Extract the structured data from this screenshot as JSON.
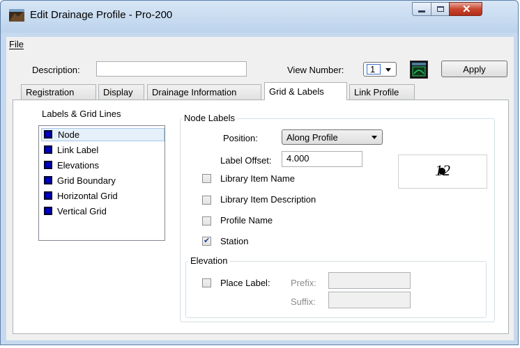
{
  "window": {
    "title": "Edit Drainage Profile - Pro-200",
    "icon": "drainage-profile-icon",
    "titlebar_buttons": [
      "minimize-icon",
      "maximize-icon",
      "close-icon"
    ]
  },
  "menu": {
    "file": "File"
  },
  "toolbar": {
    "description_label": "Description:",
    "description_value": "",
    "view_number_label": "View Number:",
    "view_number_value": "1",
    "view_icon": "view-window-icon",
    "apply_label": "Apply"
  },
  "tabs": [
    {
      "label": "Registration"
    },
    {
      "label": "Display"
    },
    {
      "label": "Drainage Information"
    },
    {
      "label": "Grid & Labels",
      "active": true
    },
    {
      "label": "Link Profile"
    }
  ],
  "labels_grid": {
    "title": "Labels & Grid Lines",
    "items": [
      "Node",
      "Link Label",
      "Elevations",
      "Grid Boundary",
      "Horizontal Grid",
      "Vertical Grid"
    ],
    "selected": "Node",
    "swatch_color": "#000080"
  },
  "node_labels": {
    "title": "Node Labels",
    "position_label": "Position:",
    "position_value": "Along Profile",
    "label_offset_label": "Label Offset:",
    "label_offset_value": "4.000",
    "preview_text": "12",
    "checkboxes": [
      {
        "label": "Library Item Name",
        "checked": false
      },
      {
        "label": "Library Item Description",
        "checked": false
      },
      {
        "label": "Profile Name",
        "checked": false
      },
      {
        "label": "Station",
        "checked": true
      }
    ]
  },
  "elevation": {
    "title": "Elevation",
    "place_label": "Place Label:",
    "place_label_checked": false,
    "prefix_label": "Prefix:",
    "prefix_value": "",
    "suffix_label": "Suffix:",
    "suffix_value": ""
  }
}
